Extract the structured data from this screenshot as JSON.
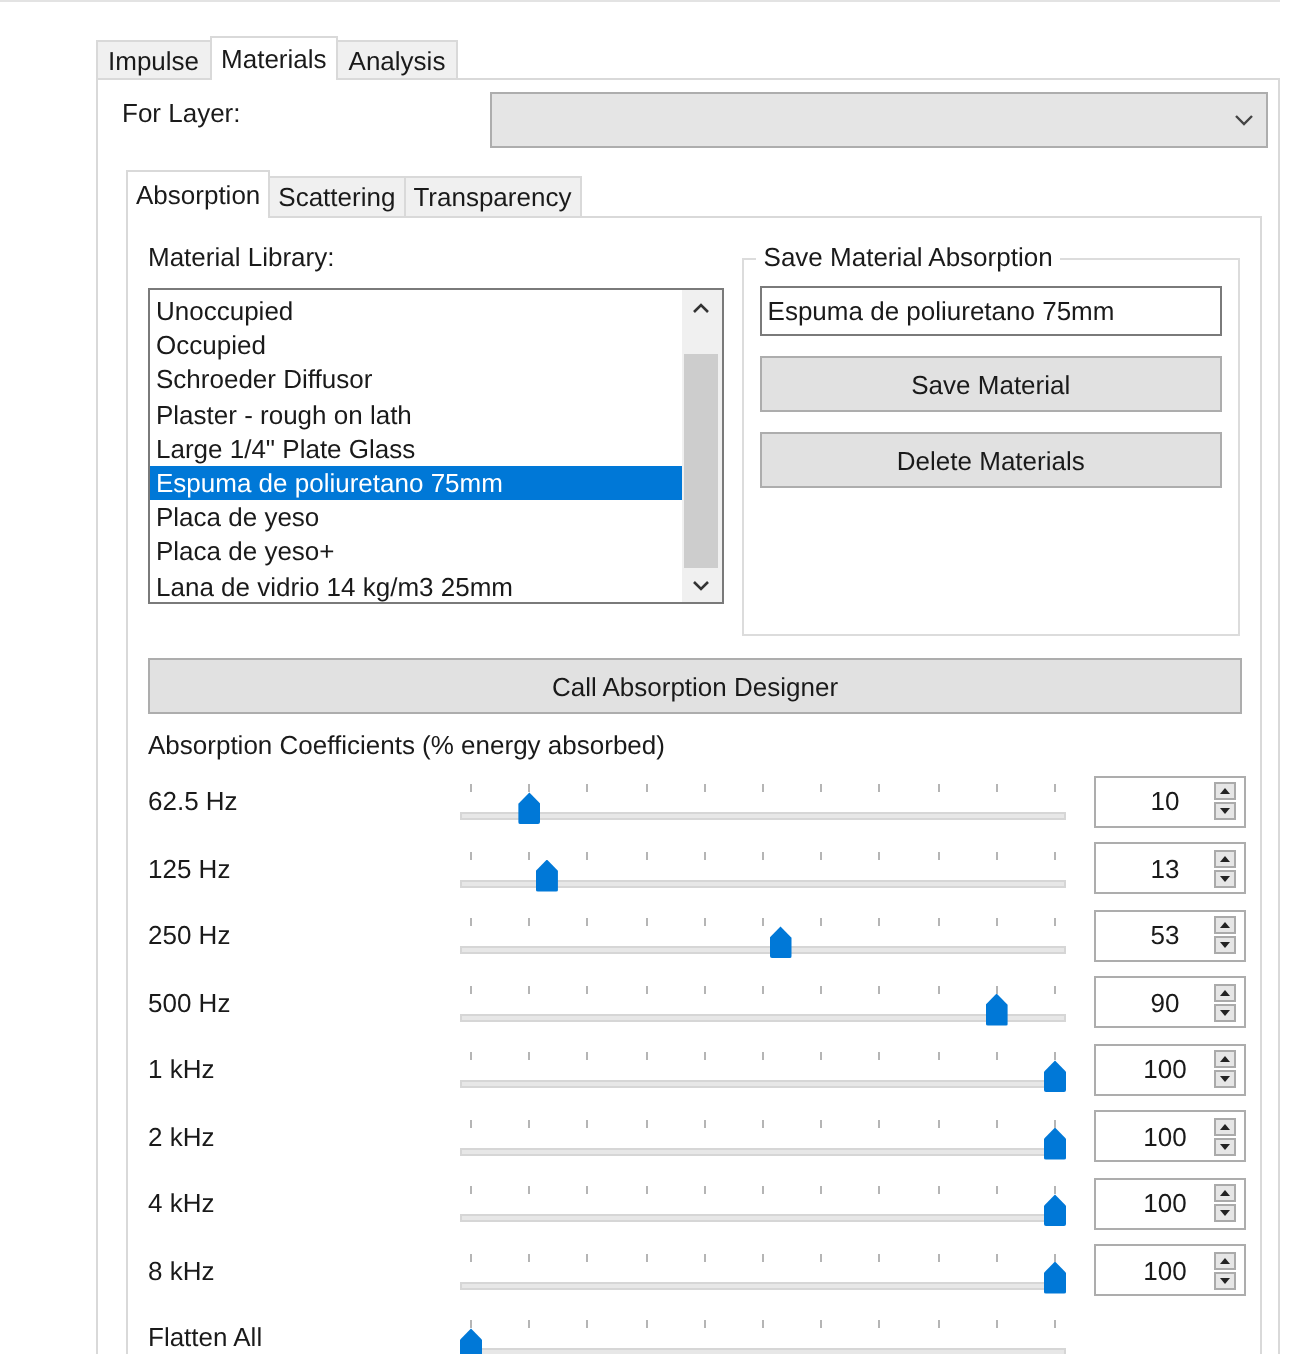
{
  "tabs": [
    {
      "label": "Impulse",
      "selected": false
    },
    {
      "label": "Materials",
      "selected": true
    },
    {
      "label": "Analysis",
      "selected": false
    }
  ],
  "for_layer": {
    "label": "For Layer:"
  },
  "material_tabs": [
    {
      "label": "Absorption",
      "selected": true
    },
    {
      "label": "Scattering",
      "selected": false
    },
    {
      "label": "Transparency",
      "selected": false
    }
  ],
  "material_library": {
    "label": "Material Library:",
    "items": [
      {
        "label": "Unoccupied",
        "selected": false
      },
      {
        "label": "Occupied",
        "selected": false
      },
      {
        "label": "Schroeder Diffusor",
        "selected": false
      },
      {
        "label": "Plaster - rough on lath",
        "selected": false
      },
      {
        "label": "Large 1/4\" Plate Glass",
        "selected": false
      },
      {
        "label": "Espuma de poliuretano 75mm",
        "selected": true
      },
      {
        "label": "Placa de yeso",
        "selected": false
      },
      {
        "label": "Placa de yeso+",
        "selected": false
      },
      {
        "label": "Lana de vidrio 14 kg/m3 25mm",
        "selected": false
      }
    ]
  },
  "save_group": {
    "title": "Save Material Absorption",
    "name": "Espuma de poliuretano 75mm",
    "buttons": [
      "Save Material",
      "Delete Materials"
    ]
  },
  "designer_button": "Call Absorption Designer",
  "coefficients": {
    "title": "Absorption Coefficients (% energy absorbed)",
    "bands": [
      {
        "label": "62.5 Hz",
        "level": 0.1,
        "value": "10"
      },
      {
        "label": "125 Hz",
        "level": 0.13,
        "value": "13"
      },
      {
        "label": "250 Hz",
        "level": 0.53,
        "value": "53"
      },
      {
        "label": "500 Hz",
        "level": 0.9,
        "value": "90"
      },
      {
        "label": "1 kHz",
        "level": 1,
        "value": "100"
      },
      {
        "label": "2 kHz",
        "level": 1,
        "value": "100"
      },
      {
        "label": "4 kHz",
        "level": 1,
        "value": "100"
      },
      {
        "label": "8 kHz",
        "level": 1,
        "value": "100"
      }
    ]
  },
  "flatten": {
    "label": "Flatten All",
    "level": 0
  }
}
